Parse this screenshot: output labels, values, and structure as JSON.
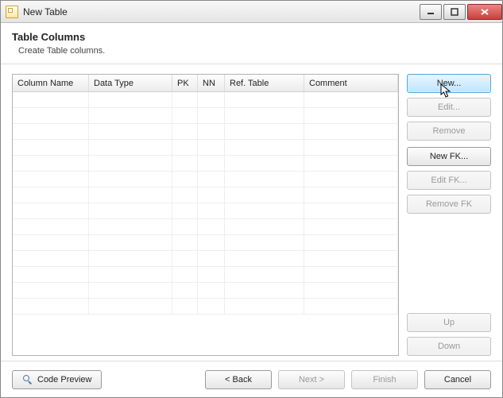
{
  "window": {
    "title": "New Table"
  },
  "header": {
    "title": "Table Columns",
    "subtitle": "Create Table columns."
  },
  "columns": {
    "name": "Column Name",
    "type": "Data Type",
    "pk": "PK",
    "nn": "NN",
    "ref": "Ref. Table",
    "comment": "Comment"
  },
  "rows": [],
  "side": {
    "new": "New...",
    "edit": "Edit...",
    "remove": "Remove",
    "newfk": "New FK...",
    "editfk": "Edit FK...",
    "removefk": "Remove FK",
    "up": "Up",
    "down": "Down"
  },
  "footer": {
    "preview": "Code Preview",
    "back": "< Back",
    "next": "Next >",
    "finish": "Finish",
    "cancel": "Cancel"
  }
}
